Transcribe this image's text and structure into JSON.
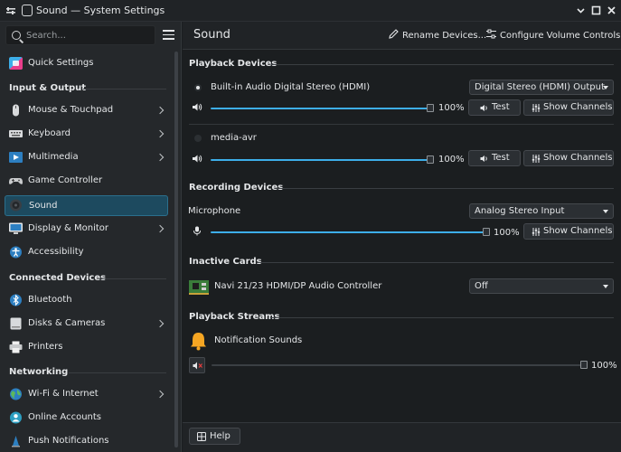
{
  "window": {
    "title": "Sound — System Settings"
  },
  "sidebar": {
    "search_placeholder": "Search...",
    "items": [
      {
        "label": "Quick Settings",
        "icon": "quick-settings-icon",
        "chevron": false
      },
      {
        "section": "Input & Output"
      },
      {
        "label": "Mouse & Touchpad",
        "icon": "mouse-icon",
        "chevron": true
      },
      {
        "label": "Keyboard",
        "icon": "keyboard-icon",
        "chevron": true
      },
      {
        "label": "Multimedia",
        "icon": "multimedia-icon",
        "chevron": true
      },
      {
        "label": "Game Controller",
        "icon": "gamepad-icon",
        "chevron": false
      },
      {
        "label": "Sound",
        "icon": "speaker-icon",
        "chevron": false,
        "selected": true
      },
      {
        "label": "Display & Monitor",
        "icon": "monitor-icon",
        "chevron": true
      },
      {
        "label": "Accessibility",
        "icon": "accessibility-icon",
        "chevron": false
      },
      {
        "section": "Connected Devices"
      },
      {
        "label": "Bluetooth",
        "icon": "bluetooth-icon",
        "chevron": false
      },
      {
        "label": "Disks & Cameras",
        "icon": "disk-icon",
        "chevron": true
      },
      {
        "label": "Printers",
        "icon": "printer-icon",
        "chevron": false
      },
      {
        "section": "Networking"
      },
      {
        "label": "Wi-Fi & Internet",
        "icon": "globe-icon",
        "chevron": true
      },
      {
        "label": "Online Accounts",
        "icon": "accounts-icon",
        "chevron": false
      },
      {
        "label": "Push Notifications",
        "icon": "notifications-icon",
        "chevron": false
      }
    ]
  },
  "header": {
    "title": "Sound",
    "rename_devices": "Rename Devices...",
    "configure_volume": "Configure Volume Controls..."
  },
  "playback": {
    "section_title": "Playback Devices",
    "devices": [
      {
        "name": "Built-in Audio Digital Stereo (HDMI)",
        "profile": "Digital Stereo (HDMI) Output",
        "volume_text": "100%",
        "volume": 1.0,
        "test_label": "Test",
        "channels_label": "Show Channels",
        "is_default": true
      },
      {
        "name": "media-avr",
        "volume_text": "100%",
        "volume": 1.0,
        "test_label": "Test",
        "channels_label": "Show Channels",
        "is_default": false
      }
    ]
  },
  "recording": {
    "section_title": "Recording Devices",
    "device": {
      "name": "Microphone",
      "profile": "Analog Stereo Input",
      "volume_text": "100%",
      "volume": 1.0,
      "channels_label": "Show Channels"
    }
  },
  "inactive": {
    "section_title": "Inactive Cards",
    "card": {
      "name": "Navi 21/23 HDMI/DP Audio Controller",
      "profile": "Off"
    }
  },
  "streams": {
    "section_title": "Playback Streams",
    "stream": {
      "name": "Notification Sounds",
      "volume_text": "100%",
      "volume": 1.0,
      "muted": true
    }
  },
  "footer": {
    "help_label": "Help"
  },
  "colors": {
    "accent": "#3daee9",
    "selection": "#1d4a5f",
    "background": "#1b1e20",
    "sidebar": "#25282b"
  }
}
